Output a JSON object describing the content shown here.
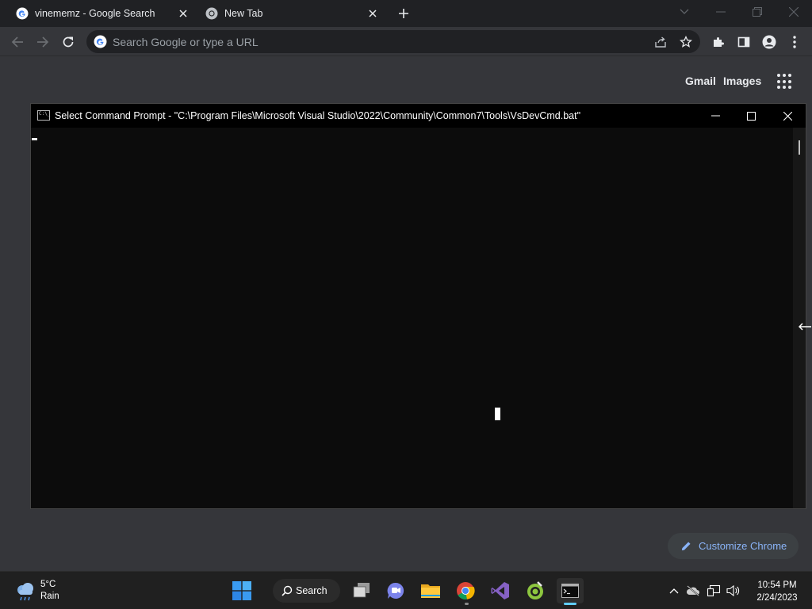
{
  "browser": {
    "tabs": [
      {
        "title": "vinememz - Google Search",
        "favicon": "google-icon",
        "active": false
      },
      {
        "title": "New Tab",
        "favicon": "chrome-icon",
        "active": true
      }
    ],
    "omnibox": {
      "placeholder": "Search Google or type a URL"
    }
  },
  "ntp": {
    "gmail_label": "Gmail",
    "images_label": "Images",
    "customize_label": "Customize Chrome"
  },
  "cmd_window": {
    "title": "Select Command Prompt - \"C:\\Program Files\\Microsoft Visual Studio\\2022\\Community\\Common7\\Tools\\VsDevCmd.bat\"",
    "icon_text": "C:\\_"
  },
  "taskbar": {
    "weather": {
      "temp": "5°C",
      "condition": "Rain"
    },
    "search_label": "Search",
    "clock": {
      "time": "10:54 PM",
      "date": "2/24/2023"
    }
  },
  "colors": {
    "chrome_frame": "#202124",
    "chrome_toolbar": "#35363a",
    "accent_link": "#8ab4f8",
    "terminal_bg": "#0c0c0c",
    "taskbar_bg": "#202020",
    "win_accent": "#60cdff"
  }
}
